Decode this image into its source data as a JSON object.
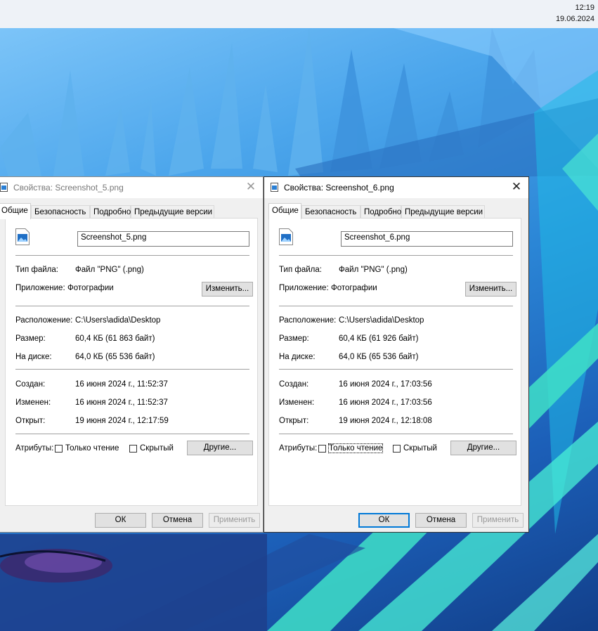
{
  "clock": {
    "time": "12:19",
    "date": "19.06.2024"
  },
  "dialogs": [
    {
      "title": "Свойства: Screenshot_5.png",
      "tabs": [
        "Общие",
        "Безопасность",
        "Подробно",
        "Предыдущие версии"
      ],
      "filename": "Screenshot_5.png",
      "type_label": "Тип файла:",
      "type_value": "Файл \"PNG\" (.png)",
      "app_label": "Приложение:",
      "app_value": "Фотографии",
      "change_btn": "Изменить...",
      "location_label": "Расположение:",
      "location_value": "C:\\Users\\adida\\Desktop",
      "size_label": "Размер:",
      "size_value": "60,4 КБ (61 863 байт)",
      "disk_label": "На диске:",
      "disk_value": "64,0 КБ (65 536 байт)",
      "created_label": "Создан:",
      "created_value": "16 июня 2024 г., 11:52:37",
      "modified_label": "Изменен:",
      "modified_value": "16 июня 2024 г., 11:52:37",
      "opened_label": "Открыт:",
      "opened_value": "19 июня 2024 г., 12:17:59",
      "attrs_label": "Атрибуты:",
      "readonly_label": "Только чтение",
      "hidden_label": "Скрытый",
      "other_btn": "Другие...",
      "ok_btn": "ОК",
      "cancel_btn": "Отмена",
      "apply_btn": "Применить"
    },
    {
      "title": "Свойства: Screenshot_6.png",
      "tabs": [
        "Общие",
        "Безопасность",
        "Подробно",
        "Предыдущие версии"
      ],
      "filename": "Screenshot_6.png",
      "type_label": "Тип файла:",
      "type_value": "Файл \"PNG\" (.png)",
      "app_label": "Приложение:",
      "app_value": "Фотографии",
      "change_btn": "Изменить...",
      "location_label": "Расположение:",
      "location_value": "C:\\Users\\adida\\Desktop",
      "size_label": "Размер:",
      "size_value": "60,4 КБ (61 926 байт)",
      "disk_label": "На диске:",
      "disk_value": "64,0 КБ (65 536 байт)",
      "created_label": "Создан:",
      "created_value": "16 июня 2024 г., 17:03:56",
      "modified_label": "Изменен:",
      "modified_value": "16 июня 2024 г., 17:03:56",
      "opened_label": "Открыт:",
      "opened_value": "19 июня 2024 г., 12:18:08",
      "attrs_label": "Атрибуты:",
      "readonly_label": "Только чтение",
      "hidden_label": "Скрытый",
      "other_btn": "Другие...",
      "ok_btn": "ОК",
      "cancel_btn": "Отмена",
      "apply_btn": "Применить"
    }
  ]
}
